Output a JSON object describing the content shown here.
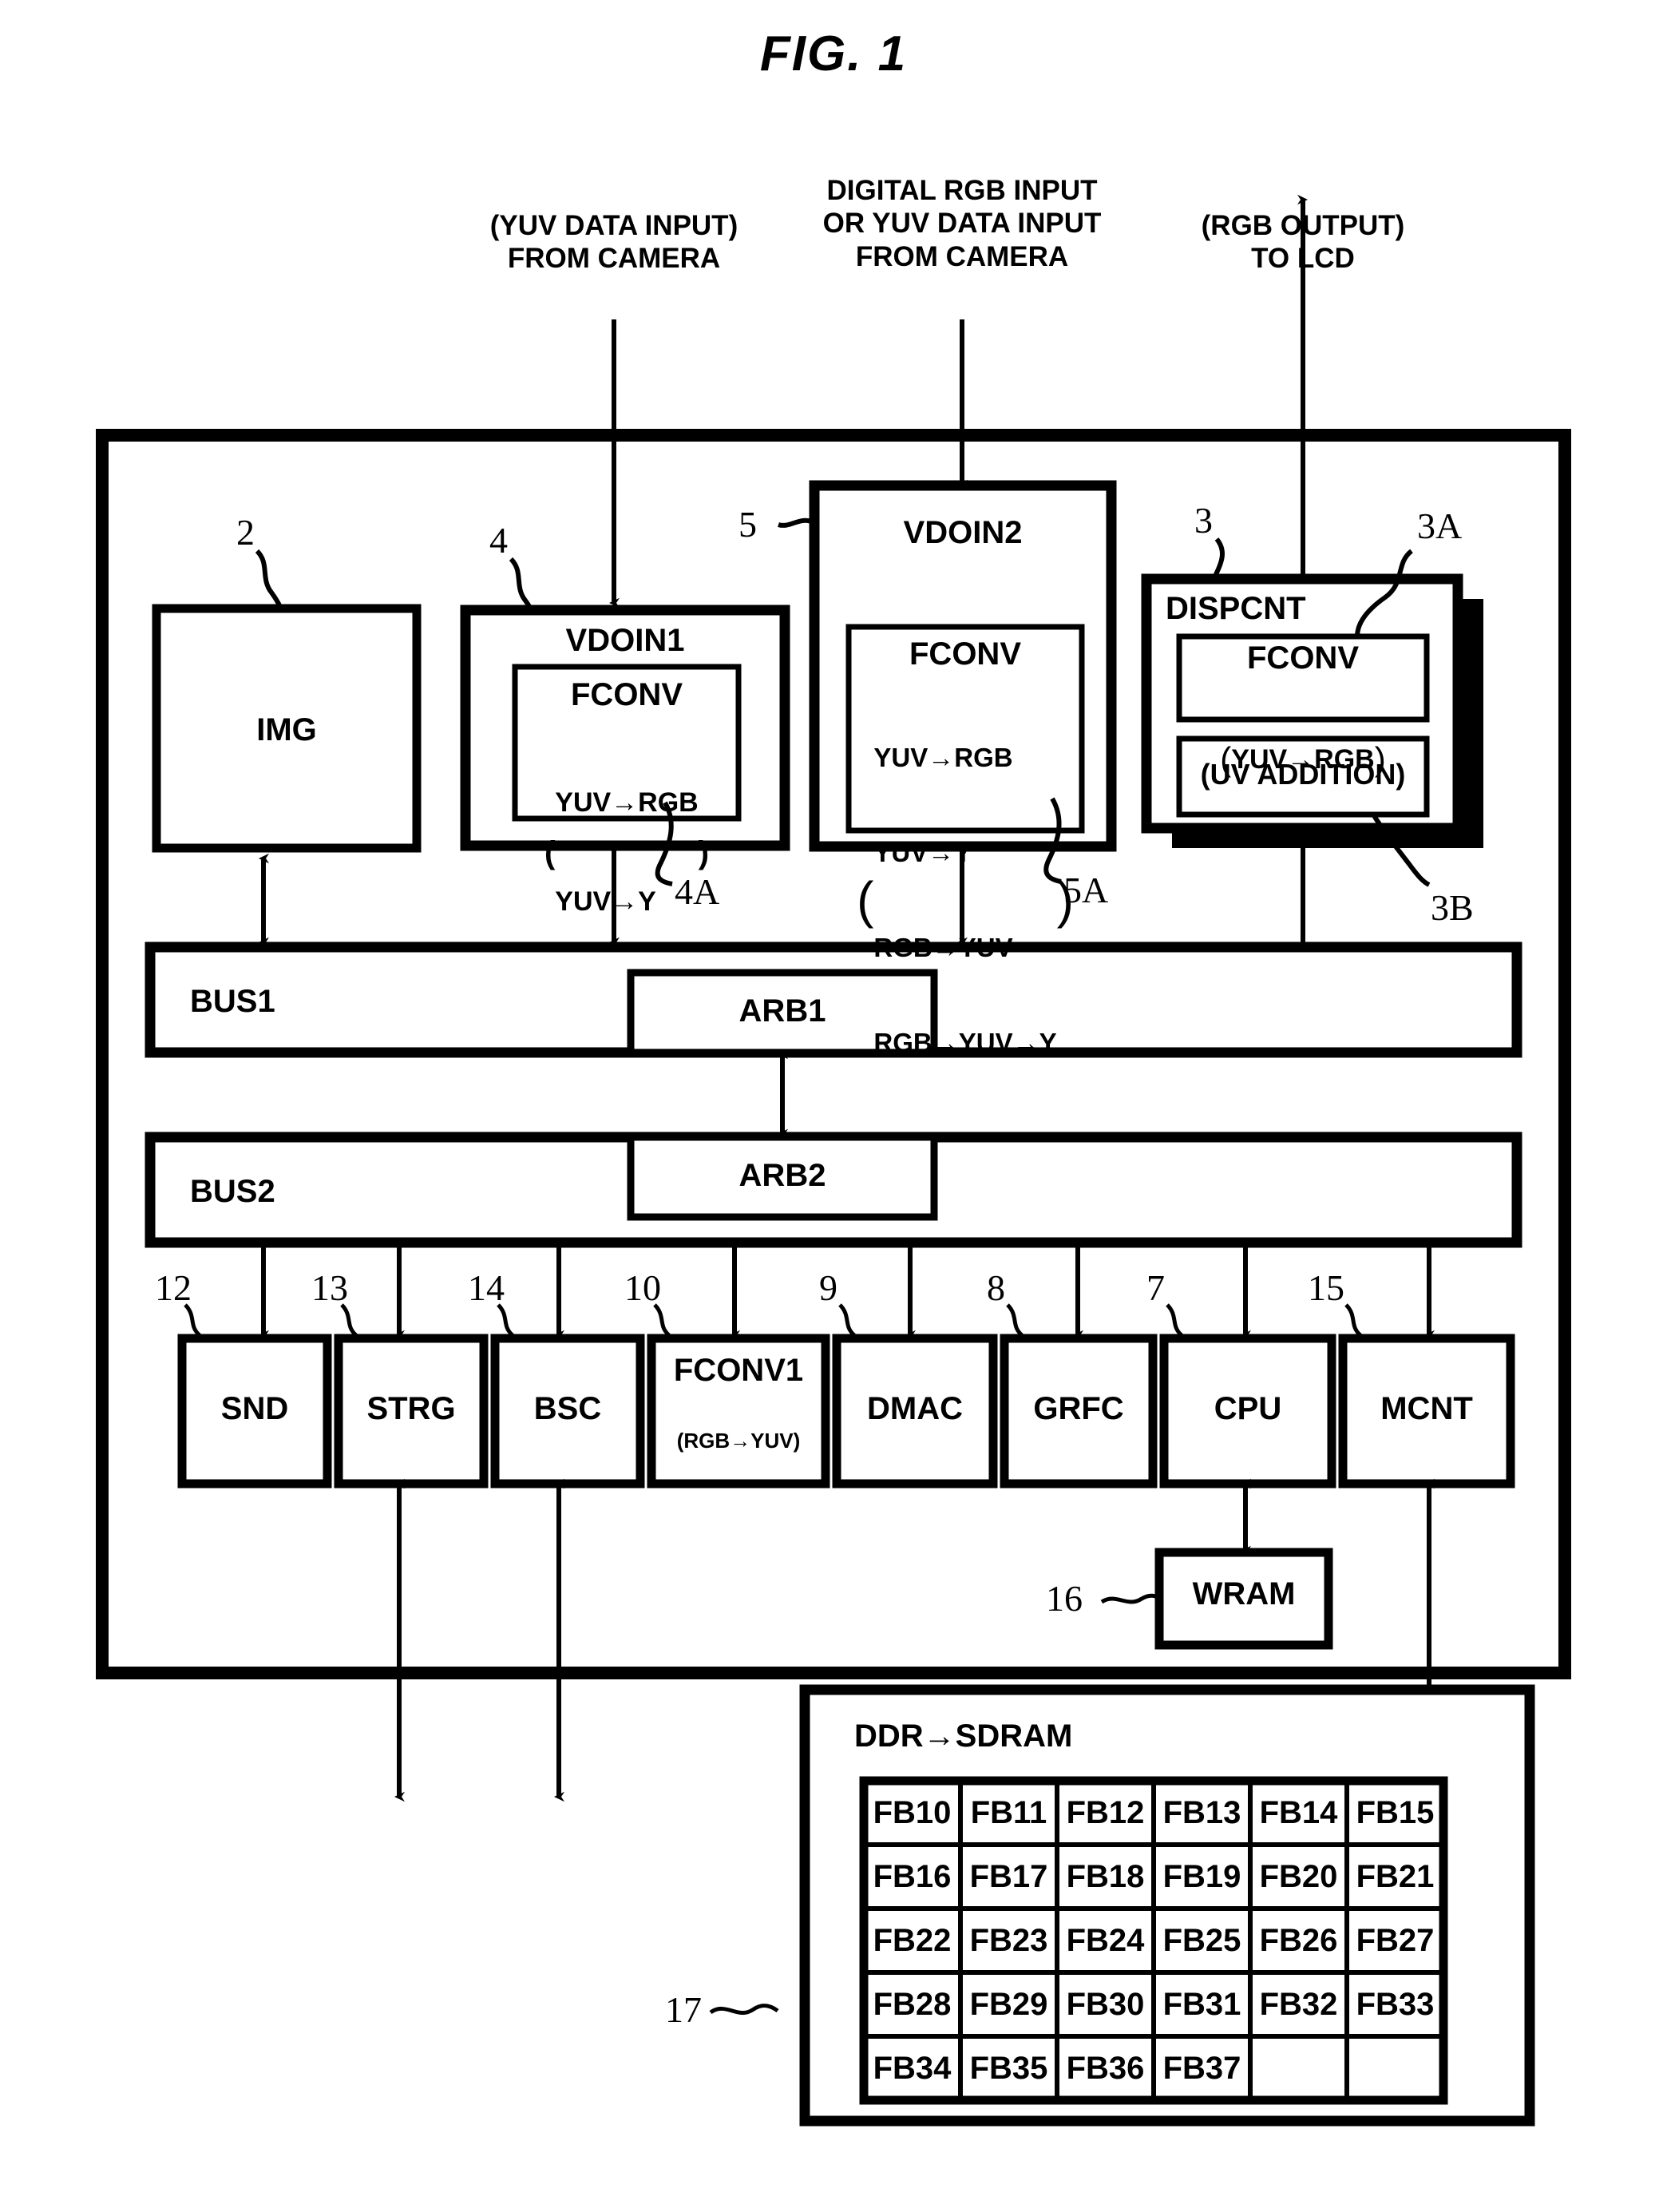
{
  "figure": {
    "title": "FIG.  1"
  },
  "io_labels": {
    "left": "(YUV DATA INPUT)\nFROM CAMERA",
    "center": "DIGITAL RGB INPUT\nOR YUV DATA INPUT\nFROM CAMERA",
    "right": "(RGB OUTPUT)\nTO LCD"
  },
  "blocks": {
    "img": {
      "label": "IMG",
      "ref": "2"
    },
    "vdoin1": {
      "label": "VDOIN1",
      "ref": "4",
      "inner": {
        "title": "FCONV",
        "ref": "4A",
        "lines": [
          "YUV→RGB",
          "YUV→Y"
        ]
      }
    },
    "vdoin2": {
      "label": "VDOIN2",
      "ref": "5",
      "inner": {
        "title": "FCONV",
        "ref": "5A",
        "lines": [
          "YUV→RGB",
          "YUV→Y",
          "RGB→YUV",
          "RGB→YUV→Y"
        ]
      }
    },
    "dispcnt": {
      "label": "DISPCNT",
      "ref": "3",
      "fconv": {
        "title": "FCONV",
        "ref": "3A",
        "lines": [
          "YUV→RGB"
        ]
      },
      "uvadd": {
        "title": "(UV ADDITION)",
        "ref": "3B"
      }
    },
    "bus1": {
      "label": "BUS1"
    },
    "arb1": {
      "label": "ARB1"
    },
    "bus2": {
      "label": "BUS2"
    },
    "arb2": {
      "label": "ARB2"
    },
    "wram": {
      "label": "WRAM",
      "ref": "16"
    },
    "sdram": {
      "label": "DDR→SDRAM",
      "ref": "17"
    }
  },
  "modules": [
    {
      "ref": "12",
      "label": "SND",
      "sub": ""
    },
    {
      "ref": "13",
      "label": "STRG",
      "sub": ""
    },
    {
      "ref": "14",
      "label": "BSC",
      "sub": ""
    },
    {
      "ref": "10",
      "label": "FCONV1",
      "sub": "(RGB→YUV)"
    },
    {
      "ref": "9",
      "label": "DMAC",
      "sub": ""
    },
    {
      "ref": "8",
      "label": "GRFC",
      "sub": ""
    },
    {
      "ref": "7",
      "label": "CPU",
      "sub": ""
    },
    {
      "ref": "15",
      "label": "MCNT",
      "sub": ""
    }
  ],
  "framebuffer_table": {
    "rows": [
      [
        "FB10",
        "FB11",
        "FB12",
        "FB13",
        "FB14",
        "FB15"
      ],
      [
        "FB16",
        "FB17",
        "FB18",
        "FB19",
        "FB20",
        "FB21"
      ],
      [
        "FB22",
        "FB23",
        "FB24",
        "FB25",
        "FB26",
        "FB27"
      ],
      [
        "FB28",
        "FB29",
        "FB30",
        "FB31",
        "FB32",
        "FB33"
      ],
      [
        "FB34",
        "FB35",
        "FB36",
        "FB37",
        "",
        ""
      ]
    ]
  },
  "colors": {
    "ink": "#000000",
    "paper": "#ffffff"
  }
}
